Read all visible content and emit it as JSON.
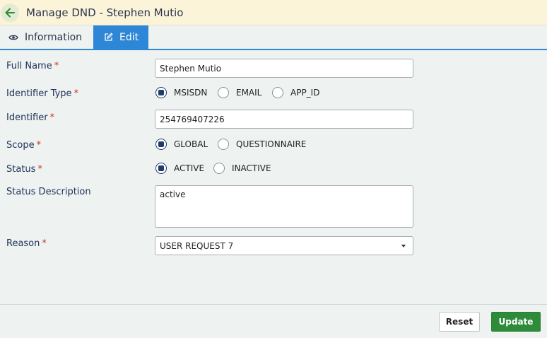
{
  "header": {
    "title": "Manage DND - Stephen Mutio"
  },
  "tabs": [
    {
      "label": "Information",
      "icon": "eye-icon"
    },
    {
      "label": "Edit",
      "icon": "edit-icon"
    }
  ],
  "form": {
    "full_name": {
      "label": "Full Name",
      "required": "*",
      "value": "Stephen Mutio"
    },
    "identifier_type": {
      "label": "Identifier Type",
      "required": "*",
      "options": [
        "MSISDN",
        "EMAIL",
        "APP_ID"
      ],
      "selected": "MSISDN"
    },
    "identifier": {
      "label": "Identifier",
      "required": "*",
      "value": "254769407226"
    },
    "scope": {
      "label": "Scope",
      "required": "*",
      "options": [
        "GLOBAL",
        "QUESTIONNAIRE"
      ],
      "selected": "GLOBAL"
    },
    "status": {
      "label": "Status",
      "required": "*",
      "options": [
        "ACTIVE",
        "INACTIVE"
      ],
      "selected": "ACTIVE"
    },
    "status_description": {
      "label": "Status Description",
      "value": "active"
    },
    "reason": {
      "label": "Reason",
      "required": "*",
      "value": "USER REQUEST 7"
    }
  },
  "buttons": {
    "reset": "Reset",
    "update": "Update"
  },
  "colors": {
    "accent": "#2e86d6",
    "primary_button": "#2e8b3a",
    "header_bg": "#fcf4d8",
    "required": "#d0312d"
  }
}
